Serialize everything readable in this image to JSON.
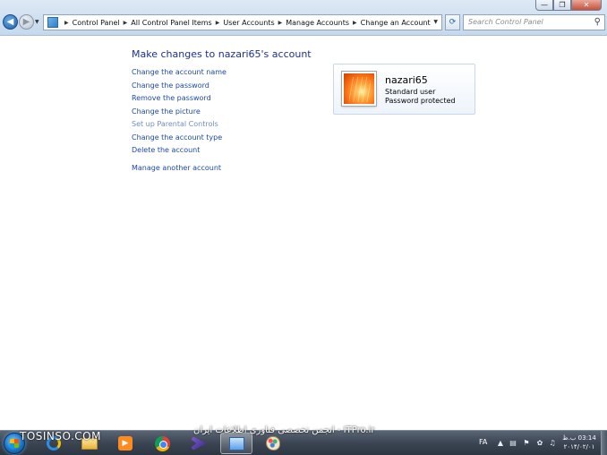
{
  "window": {
    "controls": {
      "minimize": "—",
      "maximize": "❐",
      "close": "✕"
    }
  },
  "nav": {
    "back_glyph": "◀",
    "forward_glyph": "▶",
    "history_glyph": "▼"
  },
  "address": {
    "breadcrumbs": [
      "Control Panel",
      "All Control Panel Items",
      "User Accounts",
      "Manage Accounts",
      "Change an Account"
    ],
    "separator": "▶",
    "dropdown_glyph": "▼",
    "refresh_glyph": "⟳"
  },
  "search": {
    "placeholder": "Search Control Panel",
    "icon": "magnifier"
  },
  "main": {
    "title": "Make changes to nazari65's account",
    "tasks": [
      {
        "label": "Change the account name"
      },
      {
        "label": "Change the password"
      },
      {
        "label": "Remove the password"
      },
      {
        "label": "Change the picture"
      },
      {
        "label": "Set up Parental Controls"
      },
      {
        "label": "Change the account type"
      },
      {
        "label": "Delete the account"
      }
    ],
    "other_task": "Manage another account"
  },
  "account": {
    "name": "nazari65",
    "type": "Standard user",
    "password_status": "Password protected",
    "picture": "flower-orange"
  },
  "taskbar": {
    "pinned": [
      "internet-explorer",
      "windows-explorer",
      "media-player",
      "google-chrome",
      "visual-studio",
      "control-panel",
      "paint"
    ],
    "active": "control-panel"
  },
  "watermarks": {
    "left": "TOSINSO.COM",
    "right": "ITPro.ir - انجمن تخصصی فناوری اطلاعات ایران"
  },
  "tray": {
    "language": "FA",
    "time": "03:14 ب.ظ",
    "date": "۲۰۱۴/۰۲/۰۱"
  },
  "colors": {
    "link": "#1e4aa3",
    "title": "#1e3287",
    "taskbar": "#3b4553"
  }
}
